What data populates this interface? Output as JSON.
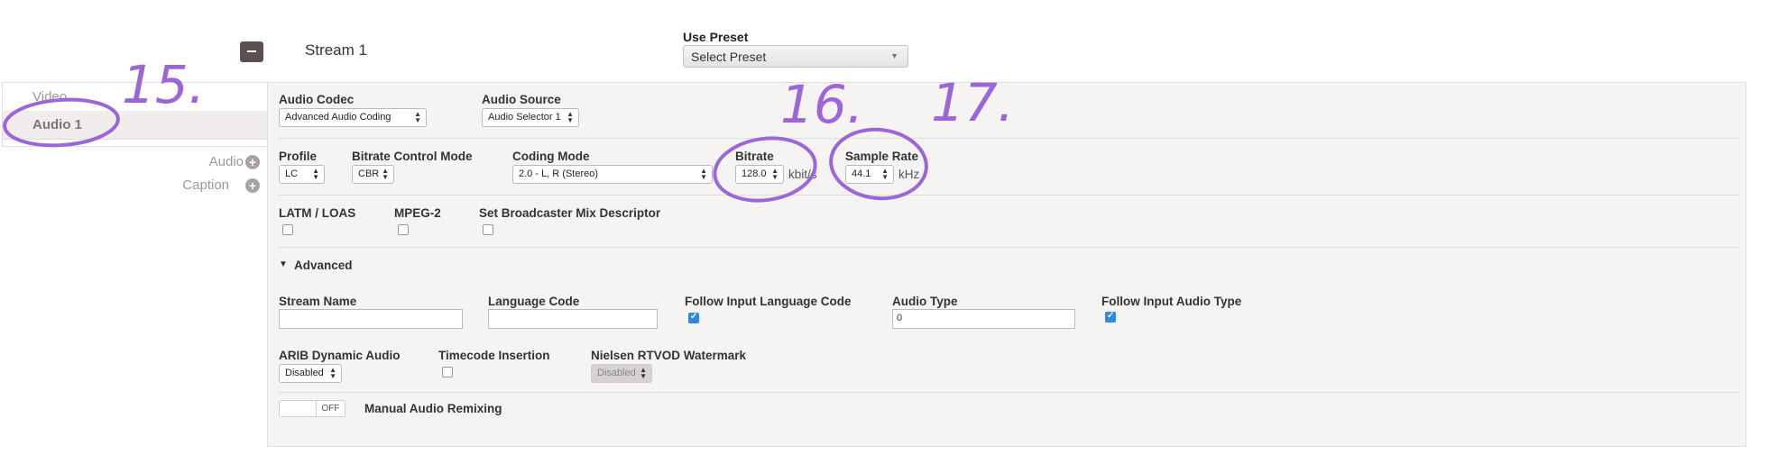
{
  "header": {
    "stream_title": "Stream 1",
    "preset_label": "Use Preset",
    "preset_value": "Select Preset"
  },
  "nav": {
    "items": [
      {
        "label": "Video"
      },
      {
        "label": "Audio 1"
      }
    ],
    "add_audio": "Audio",
    "add_caption": "Caption"
  },
  "audio": {
    "codec_label": "Audio Codec",
    "codec_value": "Advanced Audio Coding",
    "source_label": "Audio Source",
    "source_value": "Audio Selector 1",
    "profile_label": "Profile",
    "profile_value": "LC",
    "brcm_label": "Bitrate Control Mode",
    "brcm_value": "CBR",
    "coding_label": "Coding Mode",
    "coding_value": "2.0 - L, R (Stereo)",
    "bitrate_label": "Bitrate",
    "bitrate_value": "128.0",
    "bitrate_unit": "kbit/s",
    "samplerate_label": "Sample Rate",
    "samplerate_value": "44.1",
    "samplerate_unit": "kHz",
    "latm_label": "LATM / LOAS",
    "mpeg2_label": "MPEG-2",
    "broadcaster_label": "Set Broadcaster Mix Descriptor"
  },
  "advanced": {
    "toggle_label": "Advanced",
    "stream_name_label": "Stream Name",
    "stream_name_value": "",
    "language_code_label": "Language Code",
    "language_code_value": "",
    "follow_lang_label": "Follow Input Language Code",
    "follow_lang_checked": true,
    "audio_type_label": "Audio Type",
    "audio_type_value": "0",
    "follow_audio_type_label": "Follow Input Audio Type",
    "follow_audio_type_checked": true,
    "arib_label": "ARIB Dynamic Audio",
    "arib_value": "Disabled",
    "timecode_label": "Timecode Insertion",
    "nielsen_label": "Nielsen RTVOD Watermark",
    "nielsen_value": "Disabled",
    "remix_toggle_value": "OFF",
    "remix_label": "Manual Audio Remixing"
  },
  "annotations": {
    "a15": "15.",
    "a16": "16.",
    "a17": "17.",
    "color": "#9c66d8"
  }
}
